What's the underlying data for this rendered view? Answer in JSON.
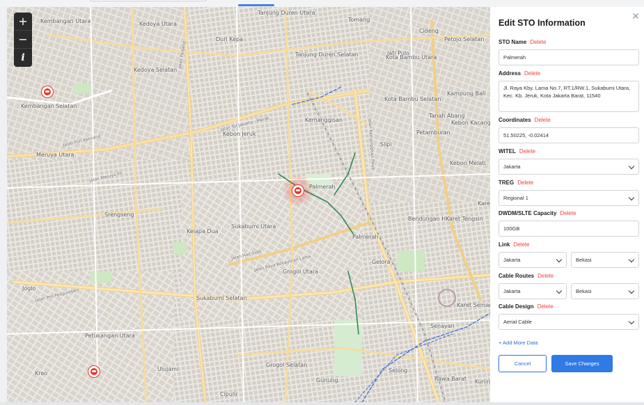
{
  "map": {
    "controls": {
      "zoom_in": "+",
      "zoom_out": "−",
      "info": "i"
    },
    "place_labels": [
      "Kembangan Utara",
      "Kedoya Utara",
      "Duri Kepa",
      "Tanjung Duren Utara",
      "Tomang",
      "Kedoya Selatan",
      "Tanjung Duren Selatan",
      "Jati Pulo",
      "Cideng",
      "Petojo Selatan",
      "Kembangan Selatan",
      "Kota Bambu Utara",
      "Kampung Bali",
      "Meruya Utara",
      "Kemanggisan",
      "Kota Bambu Selatan",
      "Tanah Abang",
      "Kebon Kacang",
      "Kebon Jeruk",
      "Slipi",
      "Petamburan",
      "Kebon Melati",
      "Palmerah",
      "Srengseng",
      "Karet",
      "Kelapa Dua",
      "Sukabumi Utara",
      "Bendungan Hilir",
      "Karet Tengsin",
      "Palmerah",
      "Gelora",
      "Grogol Utara",
      "Joglo",
      "Sukabumi Selatan",
      "Karet Semanggi",
      "Petukangan Utara",
      "Senayan",
      "Ulujami",
      "Grogol Selatan",
      "Kreo",
      "Gunung",
      "Selong",
      "Rawa Barat",
      "Kuningan",
      "Cipulir"
    ],
    "road_labels": [
      "Jalan Tol Jakarta - Merak",
      "Jalan Puri Kencana",
      "Jalan Meruya Ilir",
      "Jalan Raya Kebayoran Lama",
      "Jalan Panjang",
      "Jalan Kemanggisan Raya",
      "Jalan Haji Sidik",
      "Jalan Pos Pengumben"
    ],
    "pins": [
      "sto-pin-kembangan",
      "sto-pin-palmerah-selected",
      "sto-pin-kreo"
    ]
  },
  "panel": {
    "title": "Edit STO Information",
    "close_icon": "close-icon",
    "delete_label": "Delete",
    "fields": {
      "sto_name": {
        "label": "STO Name",
        "value": "Palmerah"
      },
      "address": {
        "label": "Address",
        "value": "Jl. Raya Kby. Lama No.7, RT.1/RW.1, Sukabumi Utara, Kec. Kb. Jeruk, Kota Jakarta Barat, 11540"
      },
      "coordinates": {
        "label": "Coordinates",
        "value": "51.50225, -0.02414"
      },
      "witel": {
        "label": "WITEL",
        "value": "Jakarta"
      },
      "treg": {
        "label": "TREG",
        "value": "Regional 1"
      },
      "capacity": {
        "label": "DWDM/SLTE Capacity",
        "value": "100GB"
      },
      "link": {
        "label": "Link",
        "from": "Jakarta",
        "to": "Bekasi"
      },
      "cable_routes": {
        "label": "Cable Routes",
        "from": "Jakarta",
        "to": "Bekasi"
      },
      "cable_design": {
        "label": "Cable Design",
        "value": "Aerial Cable"
      }
    },
    "add_more": "+ Add More Data",
    "cancel_label": "Cancel",
    "save_label": "Save Changes",
    "accent_color": "#2f7ae5",
    "delete_color": "#e9443c"
  }
}
